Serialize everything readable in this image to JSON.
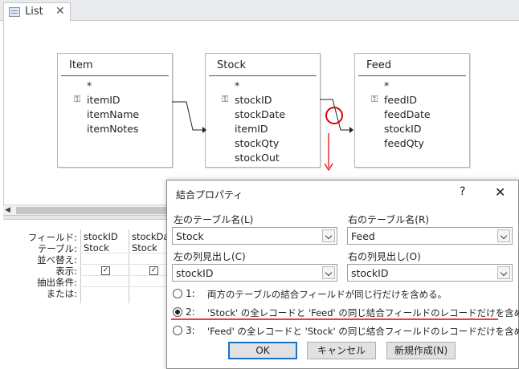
{
  "tab": {
    "title": "List",
    "close_glyph": "✕",
    "icon": "query-design-icon"
  },
  "diagram": {
    "tables": [
      {
        "title": "Item",
        "fields": [
          "*",
          "itemID",
          "itemName",
          "itemNotes"
        ],
        "key_index": 1
      },
      {
        "title": "Stock",
        "fields": [
          "*",
          "stockID",
          "stockDate",
          "itemID",
          "stockQty",
          "stockOut"
        ],
        "key_index": 1
      },
      {
        "title": "Feed",
        "fields": [
          "*",
          "feedID",
          "feedDate",
          "stockID",
          "feedQty"
        ],
        "key_index": 1
      }
    ],
    "annotation_color": "#e00000"
  },
  "grid": {
    "row_labels": [
      "フィールド:",
      "テーブル:",
      "並べ替え:",
      "表示:",
      "抽出条件:",
      "または:"
    ],
    "columns": [
      {
        "field": "stockID",
        "table": "Stock",
        "show": true
      },
      {
        "field": "stockDa",
        "table": "Stock",
        "show": true
      }
    ],
    "check_glyph": "✓"
  },
  "scroll_arrow": "◀",
  "dialog": {
    "title": "結合プロパティ",
    "help_glyph": "?",
    "close_glyph": "✕",
    "left_table_label": "左のテーブル名(L)",
    "left_table_value": "Stock",
    "right_table_label": "右のテーブル名(R)",
    "right_table_value": "Feed",
    "left_column_label": "左の列見出し(C)",
    "left_column_value": "stockID",
    "right_column_label": "右の列見出し(O)",
    "right_column_value": "stockID",
    "options": [
      {
        "num": "1:",
        "text": "両方のテーブルの結合フィールドが同じ行だけを含める。",
        "selected": false
      },
      {
        "num": "2:",
        "text": "'Stock' の全レコードと 'Feed' の同じ結合フィールドのレコードだけを含める。",
        "selected": true
      },
      {
        "num": "3:",
        "text": "'Feed' の全レコードと 'Stock' の同じ結合フィールドのレコードだけを含める。",
        "selected": false
      }
    ],
    "ok_label": "OK",
    "cancel_label": "キャンセル",
    "new_label": "新規作成(N)"
  }
}
